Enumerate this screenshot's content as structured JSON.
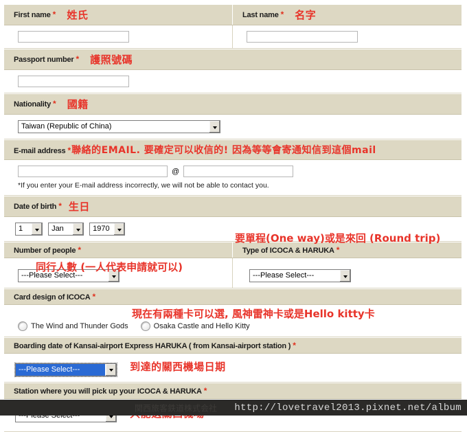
{
  "form": {
    "rows": {
      "first_name": {
        "label": "First name",
        "required": "*",
        "annotation": "姓氏",
        "input_value": "",
        "input_placeholder": ""
      },
      "last_name": {
        "label": "Last name",
        "required": "*",
        "annotation": "名字",
        "input_value": "",
        "input_placeholder": ""
      },
      "passport_number": {
        "label": "Passport number",
        "required": "*",
        "annotation": "護照號碼",
        "input_value": "",
        "input_placeholder": ""
      },
      "nationality": {
        "label": "Nationality",
        "required": "*",
        "annotation": "國籍",
        "selected": "Taiwan (Republic of China)"
      },
      "email": {
        "label": "E-mail address",
        "required": "*",
        "annotation": "聯絡的EMAIL. 要確定可以收信的! 因為等等會寄通知信到這個mail",
        "local_value": "",
        "at_symbol": "@",
        "domain_value": "",
        "note": "*If you enter your E-mail address incorrectly, we will not be able to contact you."
      },
      "date_of_birth": {
        "label": "Date of birth",
        "required": "*",
        "annotation": "生日",
        "day": "1",
        "month": "Jan",
        "year": "1970"
      },
      "number_of_people": {
        "label": "Number of people",
        "required": "*",
        "annotation": "同行人數 (一人代表申請就可以)",
        "selected": "---Please Select---"
      },
      "type_of_icoca_haruka": {
        "label": "Type of ICOCA & HARUKA",
        "required": "*",
        "annotation": "要單程(One way)或是來回 (Round trip)",
        "selected": "---Please Select---"
      },
      "card_design": {
        "label": "Card design of ICOCA",
        "required": "*",
        "annotation": "現在有兩種卡可以選, 風神雷神卡或是Hello kitty卡",
        "options": [
          "The Wind and Thunder Gods",
          "Osaka Castle and Hello Kitty"
        ]
      },
      "boarding_date": {
        "label": "Boarding date of Kansai-airport Express HARUKA ( from Kansai-airport station )",
        "required": "*",
        "annotation": "到達的關西機場日期",
        "selected": "---Please Select---"
      },
      "pickup_station": {
        "label": "Station where you will pick up your ICOCA & HARUKA",
        "required": "*",
        "annotation": "只能選關西機場",
        "selected": "---Please Select---"
      }
    }
  },
  "watermark": {
    "url": "http://lovetravel2013.pixnet.net/album",
    "ghost_text": "関西旅客鉄道株式会社"
  }
}
